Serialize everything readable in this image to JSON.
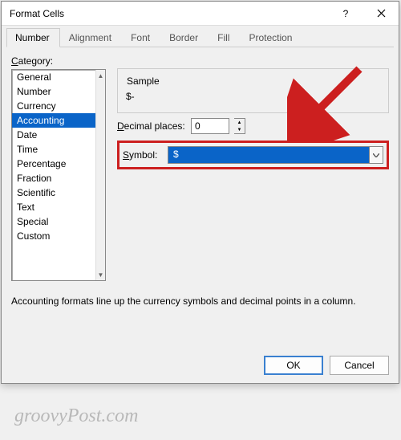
{
  "title": "Format Cells",
  "tabs": [
    "Number",
    "Alignment",
    "Font",
    "Border",
    "Fill",
    "Protection"
  ],
  "active_tab": 0,
  "category_label": "Category:",
  "categories": [
    "General",
    "Number",
    "Currency",
    "Accounting",
    "Date",
    "Time",
    "Percentage",
    "Fraction",
    "Scientific",
    "Text",
    "Special",
    "Custom"
  ],
  "selected_category_index": 3,
  "sample_label": "Sample",
  "sample_value": "$-",
  "decimal_label": "Decimal places:",
  "decimal_value": "0",
  "symbol_label": "Symbol:",
  "symbol_value": "$",
  "description": "Accounting formats line up the currency symbols and decimal points in a column.",
  "ok_label": "OK",
  "cancel_label": "Cancel",
  "watermark": "groovyPost.com"
}
